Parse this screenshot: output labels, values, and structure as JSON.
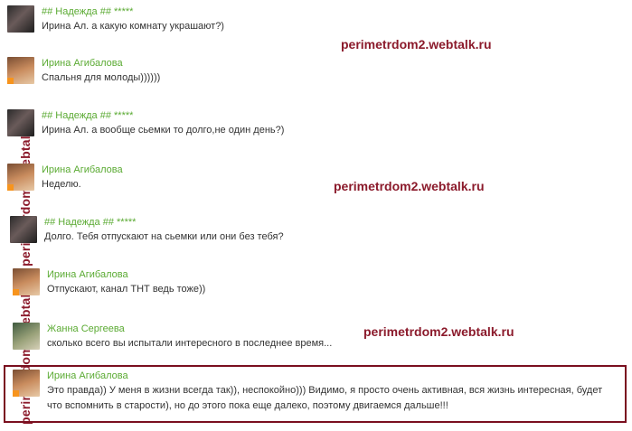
{
  "messages": [
    {
      "author": "## Надежда ## *****",
      "text": "Ирина Ал. а какую комнату украшают?)",
      "avatar": "nadezhda-avatar"
    },
    {
      "author": "Ирина Агибалова",
      "text": "Спальня для молоды))))))",
      "avatar": "irina-avatar"
    },
    {
      "author": "## Надежда ## *****",
      "text": "Ирина Ал. а вообще сьемки то долго,не один день?)",
      "avatar": "nadezhda-avatar"
    },
    {
      "author": "Ирина Агибалова",
      "text": "Неделю.",
      "avatar": "irina-avatar"
    },
    {
      "author": "## Надежда ## *****",
      "text": "Долго. Тебя отпускают на сьемки или они без тебя?",
      "avatar": "nadezhda-avatar"
    },
    {
      "author": "Ирина Агибалова",
      "text": "Отпускают, канал ТНТ ведь тоже))",
      "avatar": "irina-avatar"
    },
    {
      "author": "Жанна Сергеева",
      "text": "сколько всего вы испытали интересного в последнее время...",
      "avatar": "zhanna-avatar"
    },
    {
      "author": "Ирина Агибалова",
      "text_line1": "Это правда)) У меня в жизни всегда так)), неспокойно))) Видимо, я просто очень активная, вся жизнь интересная, будет",
      "text_line2": "что вспомнить в старости), но до этого пока еще далеко, поэтому двигаемся дальше!!!",
      "avatar": "irina-avatar",
      "highlighted": true
    }
  ],
  "watermarks": [
    "perimetrdom2.webtalk.ru",
    "perimetrdom2.webtalk.ru",
    "perimetrdom2.webtalk.ru"
  ],
  "vertical_watermark": "perimetrdom2.webtalk.ru perimetrdom2.webtalk.ru",
  "colors": {
    "author": "#5aaa32",
    "watermark": "#8b1a2b",
    "highlight_border": "#7a0f1f",
    "status": "#f7941d"
  }
}
